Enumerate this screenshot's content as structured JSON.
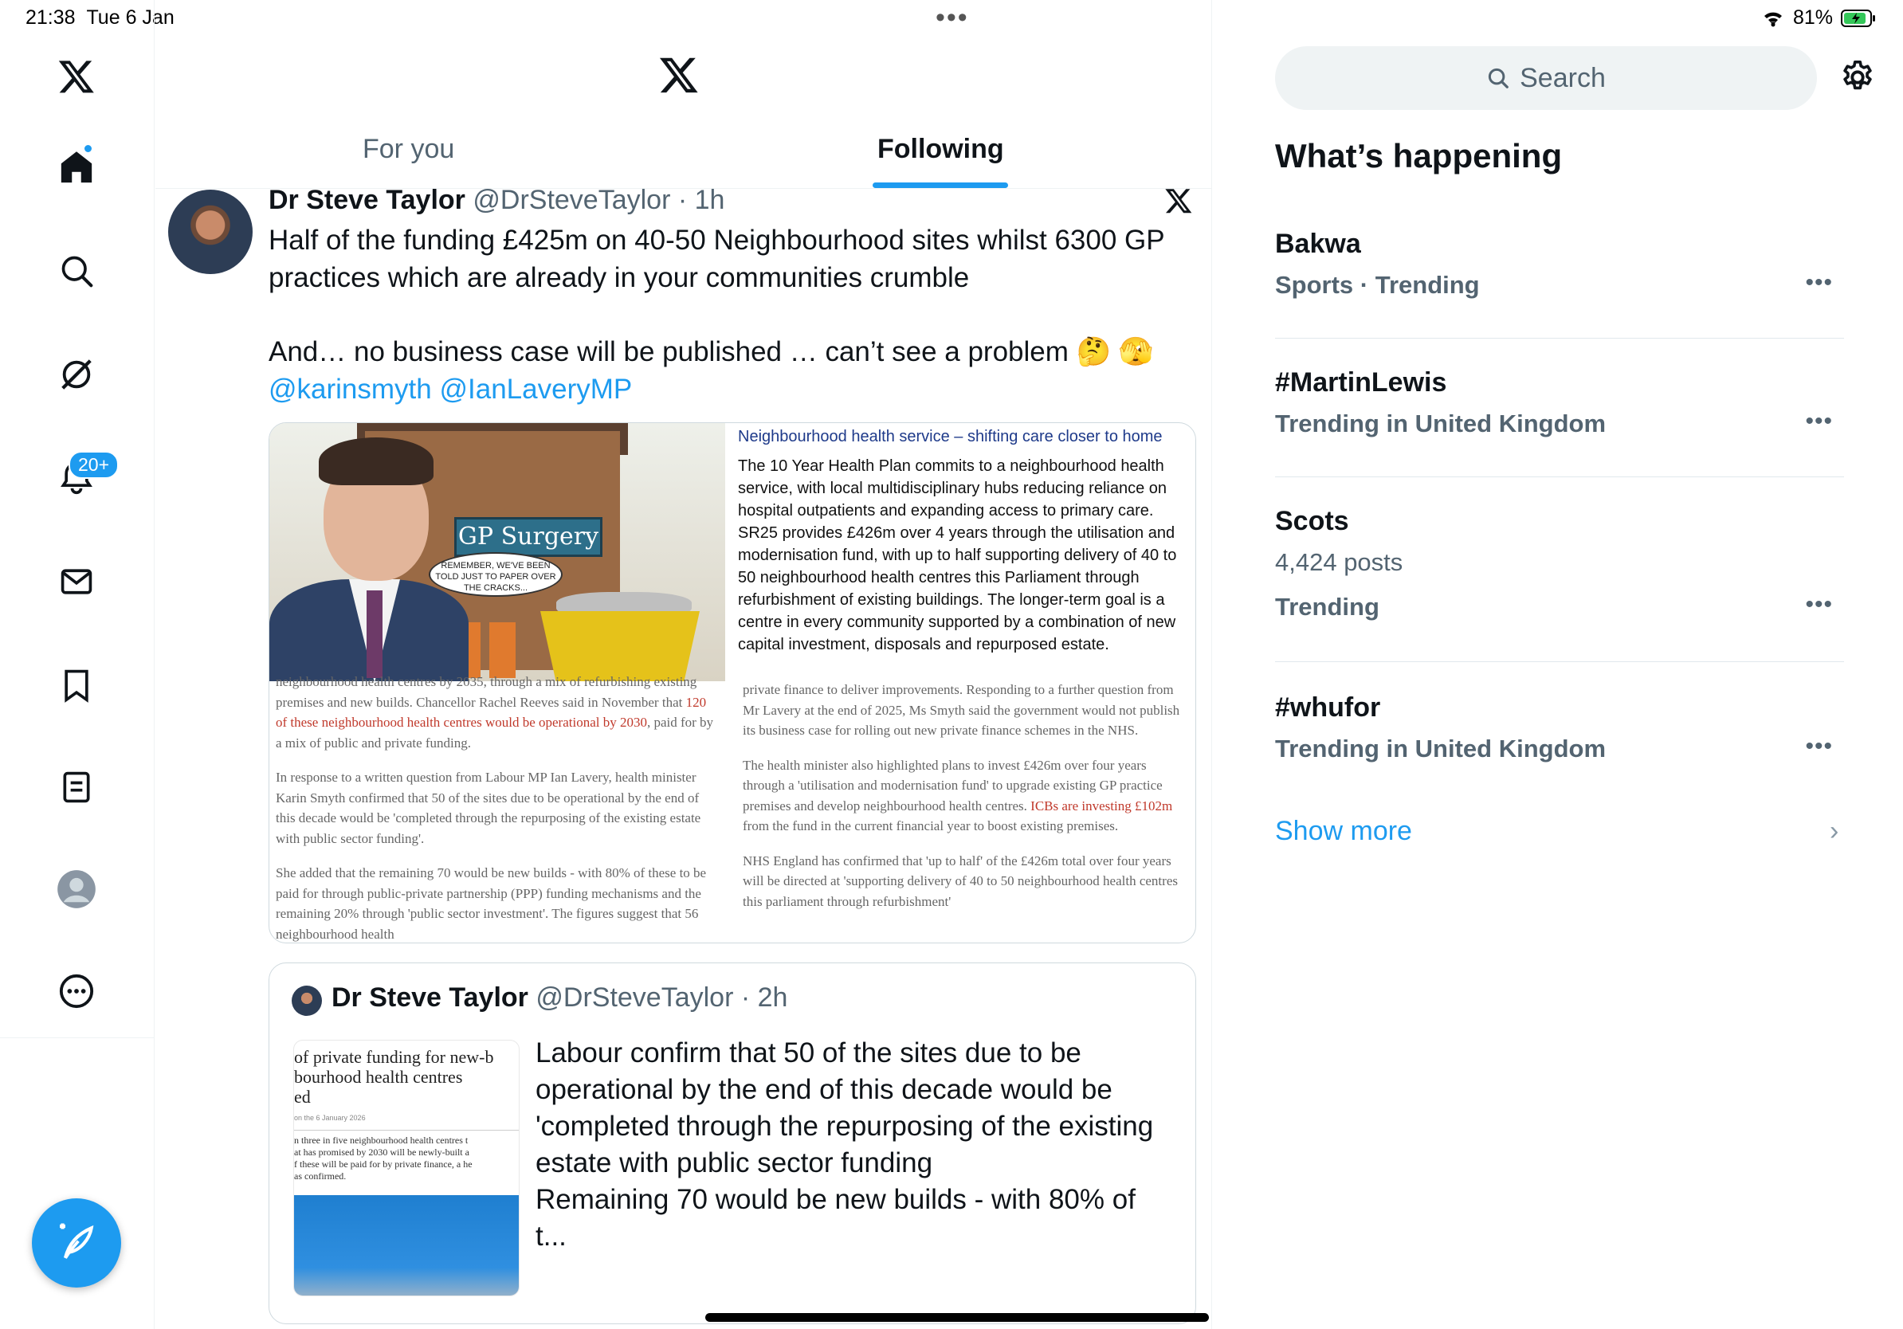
{
  "status": {
    "time": "21:38",
    "date": "Tue 6 Jan",
    "battery": "81%"
  },
  "nav": {
    "notifications_badge": "20+"
  },
  "tabs": {
    "for_you": "For you",
    "following": "Following"
  },
  "tweet": {
    "name": "Dr Steve Taylor",
    "handle": "@DrSteveTaylor",
    "time": "· 1h",
    "text1": "Half of the funding £425m on 40-50 Neighbourhood sites whilst 6300 GP practices which are already in your communities crumble",
    "text2": "And… no business case will be published … can’t see a problem 🤔 🫣",
    "mention1": "@karinsmyth",
    "mention2": "@IanLaveryMP"
  },
  "media": {
    "sign": "GP Surgery",
    "bubble": "REMEMBER, WE'VE BEEN TOLD JUST TO PAPER OVER THE CRACKS...",
    "panel_heading": "Neighbourhood health service – shifting care closer to home",
    "panel_body": "The 10 Year Health Plan commits to a neighbourhood health service, with local multidisciplinary hubs reducing reliance on hospital outpatients and expanding access to primary care. SR25 provides £426m over 4 years through the utilisation and modernisation fund, with up to half supporting delivery of 40 to 50 neighbourhood health centres this Parliament through refurbishment of existing buildings. The longer-term goal is a centre in every community supported by a combination of new capital investment, disposals and repurposed estate.",
    "left_p1a": "neighbourhood health centres by 2035, through a mix of refurbishing existing premises and new builds. Chancellor Rachel Reeves said in November that ",
    "left_p1_link": "120 of these neighbourhood health centres would be operational by 2030",
    "left_p1b": ", paid for by a mix of public and private funding.",
    "left_p2": "In response to a written question from Labour MP Ian Lavery, health minister Karin Smyth confirmed that 50 of the sites due to be operational by the end of this decade would be 'completed through the repurposing of the existing estate with public sector funding'.",
    "left_p3": "She added that the remaining 70 would be new builds - with 80% of these to be paid for through public-private partnership (PPP) funding mechanisms and the remaining 20% through 'public sector investment'. The figures suggest that 56 neighbourhood health",
    "right_p1": "private finance to deliver improvements. Responding to a further question from Mr Lavery at the end of 2025, Ms Smyth said the government would not publish its business case for rolling out new private finance schemes in the NHS.",
    "right_p2a": "The health minister also highlighted plans to invest £426m over four years through a 'utilisation and modernisation fund' to upgrade existing GP practice premises and develop neighbourhood health centres. ",
    "right_p2_link": "ICBs are investing £102m",
    "right_p2b": " from the fund in the current financial year to boost existing premises.",
    "right_p3": "NHS England has confirmed that 'up to half' of the £426m total over four years will be directed at 'supporting delivery of 40 to 50 neighbourhood health centres this parliament through refurbishment'"
  },
  "quote": {
    "name": "Dr Steve Taylor",
    "handle": "@DrSteveTaylor",
    "time": "· 2h",
    "thumb_title": "of private funding for new-b\nbourhood health centres\ned",
    "thumb_date": "on the 6 January 2026",
    "thumb_body": "n three in five neighbourhood health centres t\nat has promised by 2030 will be newly-built a\nf these will be paid for by private finance, a he\nas confirmed.",
    "text1": "Labour confirm that 50 of the sites due to be operational by the end of this decade would be 'completed through the repurposing of the existing estate with public sector funding",
    "text2": "Remaining 70 would be new builds - with 80% of t..."
  },
  "right": {
    "search_placeholder": "Search",
    "heading": "What’s happening",
    "trends": [
      {
        "title": "Bakwa",
        "meta": "Sports · Trending"
      },
      {
        "title": "#MartinLewis",
        "meta": "Trending in United Kingdom"
      },
      {
        "title": "Scots",
        "count": "4,424 posts",
        "meta": "Trending"
      },
      {
        "title": "#whufor",
        "meta": "Trending in United Kingdom"
      }
    ],
    "show_more": "Show more"
  },
  "colors": {
    "accent": "#1d9bf0",
    "text": "#0f1419",
    "muted": "#536471"
  }
}
